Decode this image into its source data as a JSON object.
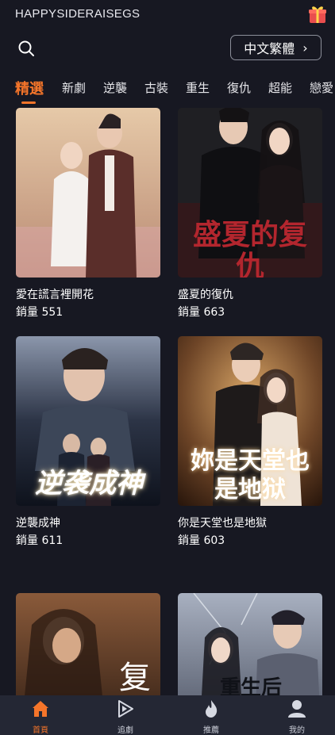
{
  "header": {
    "brand": "HAPPYSIDERAISEGS",
    "language_label": "中文繁體"
  },
  "tabs": [
    {
      "label": "精選",
      "active": true
    },
    {
      "label": "新劇"
    },
    {
      "label": "逆襲"
    },
    {
      "label": "古裝"
    },
    {
      "label": "重生"
    },
    {
      "label": "復仇"
    },
    {
      "label": "超能"
    },
    {
      "label": "戀愛"
    }
  ],
  "dramas": [
    {
      "title": "愛在謊言裡開花",
      "sales": "銷量 551",
      "poster_text": "",
      "palette": [
        "#c9a58a",
        "#7c4a3a"
      ]
    },
    {
      "title": "盛夏的復仇",
      "sales": "銷量 663",
      "poster_text": "盛夏的复仇",
      "palette": [
        "#2a2a2e",
        "#5a1a1e"
      ]
    },
    {
      "title": "逆襲成神",
      "sales": "銷量 611",
      "poster_text": "逆袭成神",
      "palette": [
        "#5b6b86",
        "#141a28"
      ]
    },
    {
      "title": "你是天堂也是地獄",
      "sales": "銷量 603",
      "poster_text": "妳是天堂也是地狱",
      "palette": [
        "#a87340",
        "#3a2214"
      ]
    },
    {
      "title": "",
      "sales": "",
      "poster_text": "",
      "palette": [
        "#6b4530",
        "#1e120c"
      ]
    },
    {
      "title": "",
      "sales": "",
      "poster_text": "",
      "palette": [
        "#8a93a6",
        "#2b3140"
      ]
    }
  ],
  "nav": [
    {
      "label": "首頁",
      "icon": "home-icon",
      "active": true
    },
    {
      "label": "追劇",
      "icon": "play-icon"
    },
    {
      "label": "推薦",
      "icon": "flame-icon"
    },
    {
      "label": "我的",
      "icon": "user-icon"
    }
  ],
  "colors": {
    "accent": "#f5752a",
    "background": "#171822",
    "nav_background": "#242734"
  }
}
